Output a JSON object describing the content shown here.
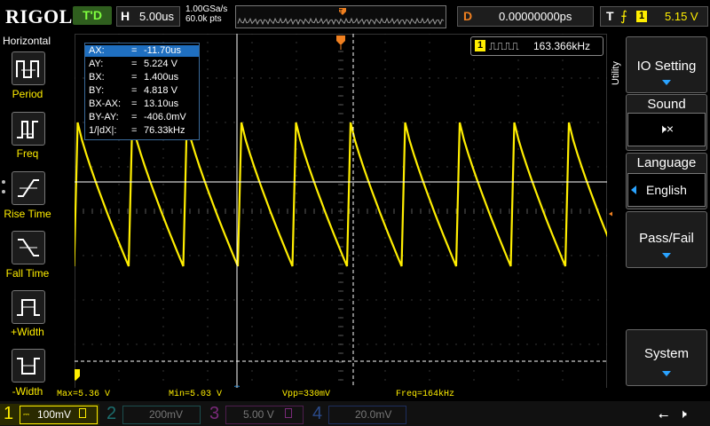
{
  "header": {
    "logo": "RIGOL",
    "trigger_status": "T'D",
    "horizontal": {
      "label": "H",
      "value": "5.00us"
    },
    "sample_rate": "1.00GSa/s",
    "memory_points": "60.0k pts",
    "delay": {
      "label": "D",
      "value": "0.00000000ps"
    },
    "trigger": {
      "label": "T",
      "source": "1",
      "level": "5.15 V"
    }
  },
  "left_menu": {
    "title": "Horizontal",
    "items": [
      {
        "label": "Period"
      },
      {
        "label": "Freq"
      },
      {
        "label": "Rise Time"
      },
      {
        "label": "Fall Time"
      },
      {
        "label": "+Width"
      },
      {
        "label": "-Width"
      }
    ]
  },
  "right_menu": {
    "side_label": "Utility",
    "io_setting": "IO Setting",
    "sound": "Sound",
    "language": "Language",
    "language_value": "English",
    "pass_fail": "Pass/Fail",
    "system": "System"
  },
  "cursor_table": [
    {
      "key": "AX:",
      "value": "-11.70us"
    },
    {
      "key": "AY:",
      "value": "5.224 V"
    },
    {
      "key": "BX:",
      "value": "1.400us"
    },
    {
      "key": "BY:",
      "value": "4.818 V"
    },
    {
      "key": "BX-AX:",
      "value": "13.10us"
    },
    {
      "key": "BY-AY:",
      "value": "-406.0mV"
    },
    {
      "key": "1/|dX|:",
      "value": "76.33kHz"
    }
  ],
  "freq_counter": {
    "channel": "1",
    "value": "163.366kHz"
  },
  "measurements": {
    "max": "Max=5.36 V",
    "min": "Min=5.03 V",
    "vpp": "Vpp=330mV",
    "freq": "Freq=164kHz"
  },
  "channels": [
    {
      "num": "1",
      "scale": "100mV",
      "color": "#ffee00",
      "active": true
    },
    {
      "num": "2",
      "scale": "200mV",
      "color": "#00c8c8",
      "active": false
    },
    {
      "num": "3",
      "scale": "5.00 V",
      "color": "#e040e0",
      "active": false
    },
    {
      "num": "4",
      "scale": "20.0mV",
      "color": "#3a7ae0",
      "active": false
    }
  ],
  "colors": {
    "ch1": "#ffee00",
    "accent": "#2aa3ff",
    "orange": "#f08020"
  }
}
